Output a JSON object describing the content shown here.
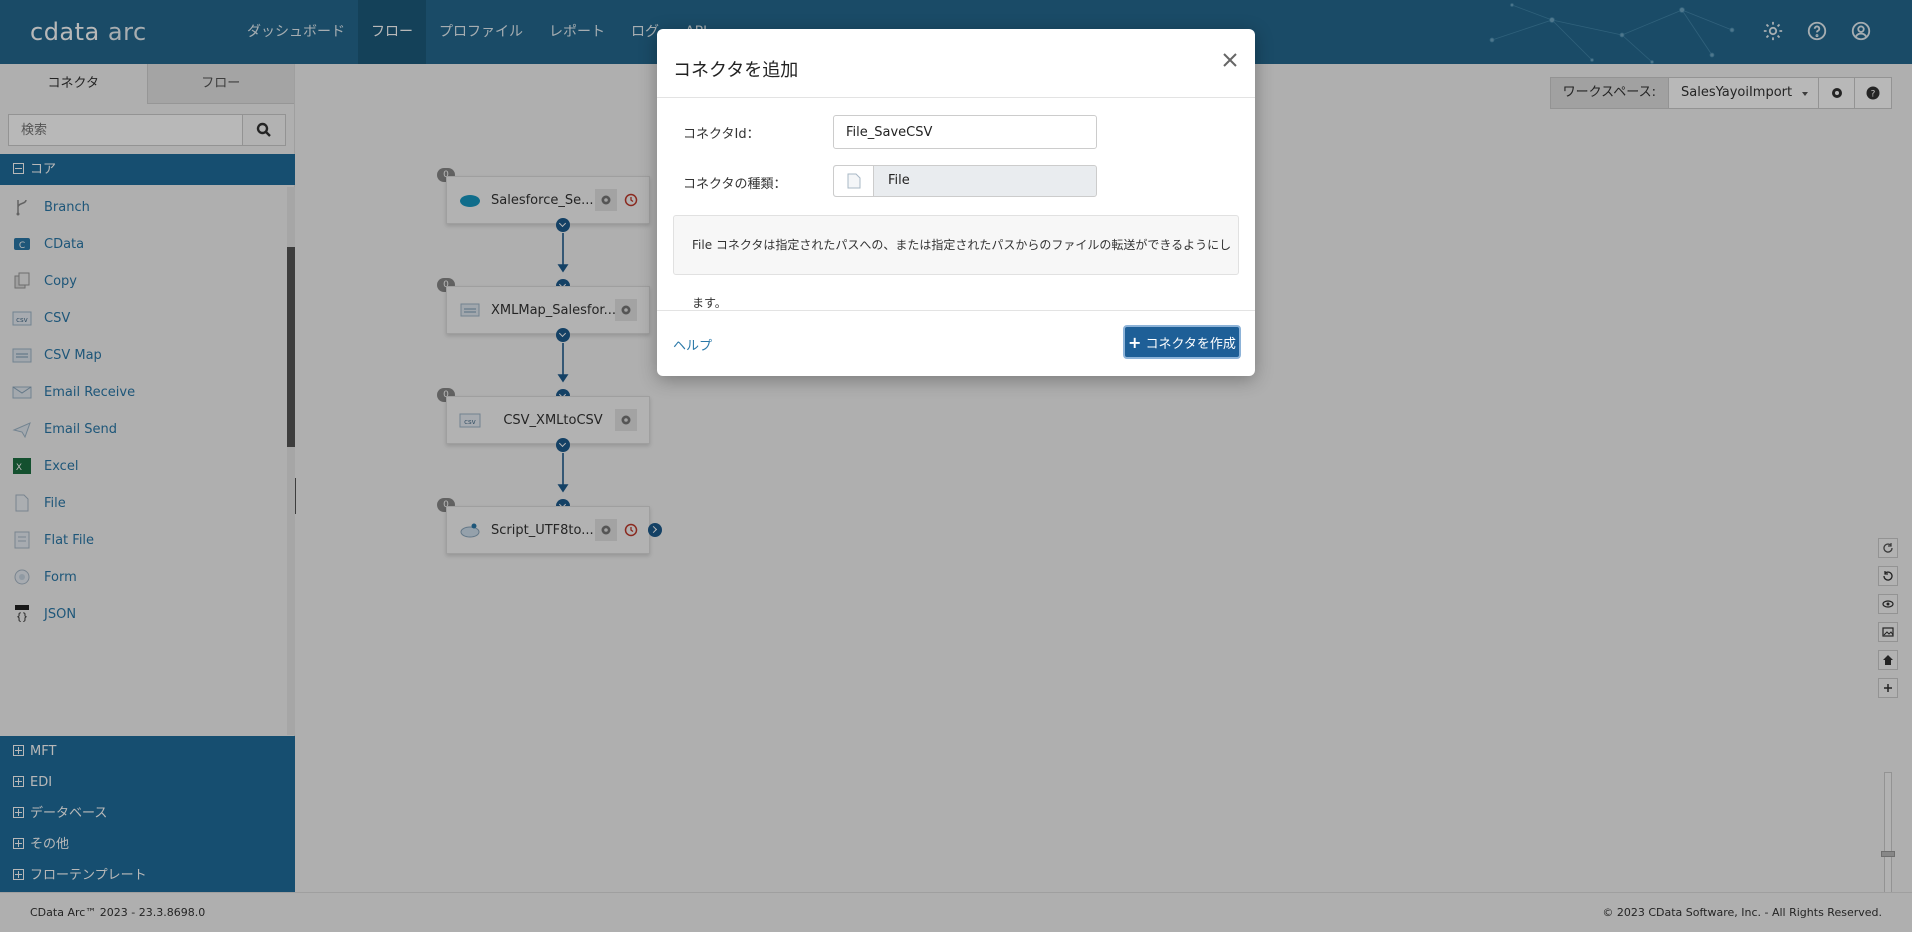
{
  "app": {
    "logo_main": "cdata",
    "logo_sub": "arc"
  },
  "nav": {
    "items": [
      {
        "label": "ダッシュボード"
      },
      {
        "label": "フロー",
        "active": true
      },
      {
        "label": "プロファイル"
      },
      {
        "label": "レポート"
      },
      {
        "label": "ログ"
      },
      {
        "label": "API"
      }
    ],
    "icons": [
      "gear-icon",
      "help-icon",
      "user-icon"
    ]
  },
  "sidebar": {
    "tabs": [
      {
        "label": "コネクタ"
      },
      {
        "label": "フロー"
      }
    ],
    "search_placeholder": "検索",
    "core_label": "コア",
    "connectors": [
      {
        "label": "Branch",
        "icon": "branch-icon"
      },
      {
        "label": "CData",
        "icon": "cdata-icon"
      },
      {
        "label": "Copy",
        "icon": "copy-icon"
      },
      {
        "label": "CSV",
        "icon": "csv-icon"
      },
      {
        "label": "CSV Map",
        "icon": "csv-map-icon"
      },
      {
        "label": "Email Receive",
        "icon": "email-receive-icon"
      },
      {
        "label": "Email Send",
        "icon": "email-send-icon"
      },
      {
        "label": "Excel",
        "icon": "excel-icon"
      },
      {
        "label": "File",
        "icon": "file-icon"
      },
      {
        "label": "Flat File",
        "icon": "flat-file-icon"
      },
      {
        "label": "Form",
        "icon": "form-icon"
      },
      {
        "label": "JSON",
        "icon": "json-icon"
      }
    ],
    "categories": [
      {
        "label": "MFT"
      },
      {
        "label": "EDI"
      },
      {
        "label": "データベース"
      },
      {
        "label": "その他"
      },
      {
        "label": "フローテンプレート"
      }
    ]
  },
  "workspace": {
    "label": "ワークスペース:",
    "value": "SalesYayoiImport"
  },
  "flow": {
    "nodes": [
      {
        "label": "Salesforce_Se...",
        "badge": "0",
        "icon": "salesforce-icon"
      },
      {
        "label": "XMLMap_Salesfor...",
        "badge": "0",
        "icon": "xmlmap-icon"
      },
      {
        "label": "CSV_XMLtoCSV",
        "badge": "0",
        "icon": "csv-icon"
      },
      {
        "label": "Script_UTF8to...",
        "badge": "0",
        "icon": "script-icon"
      }
    ]
  },
  "modal": {
    "title": "コネクタを追加",
    "id_label": "コネクタId：",
    "id_value": "File_SaveCSV",
    "type_label": "コネクタの種類：",
    "type_value": "File",
    "description": "File コネクタは指定されたパスへの、または指定されたパスからのファイルの転送ができるようにします。",
    "help": "ヘルプ",
    "create": "コネクタを作成"
  },
  "footer": {
    "version": "CData Arc™ 2023 - 23.3.8698.0",
    "copyright": "© 2023 CData Software, Inc. - All Rights Reserved."
  },
  "colors": {
    "header": "#24698f",
    "accent": "#1f6d9c",
    "link": "#2a78a8",
    "port": "#1d5a8c"
  }
}
